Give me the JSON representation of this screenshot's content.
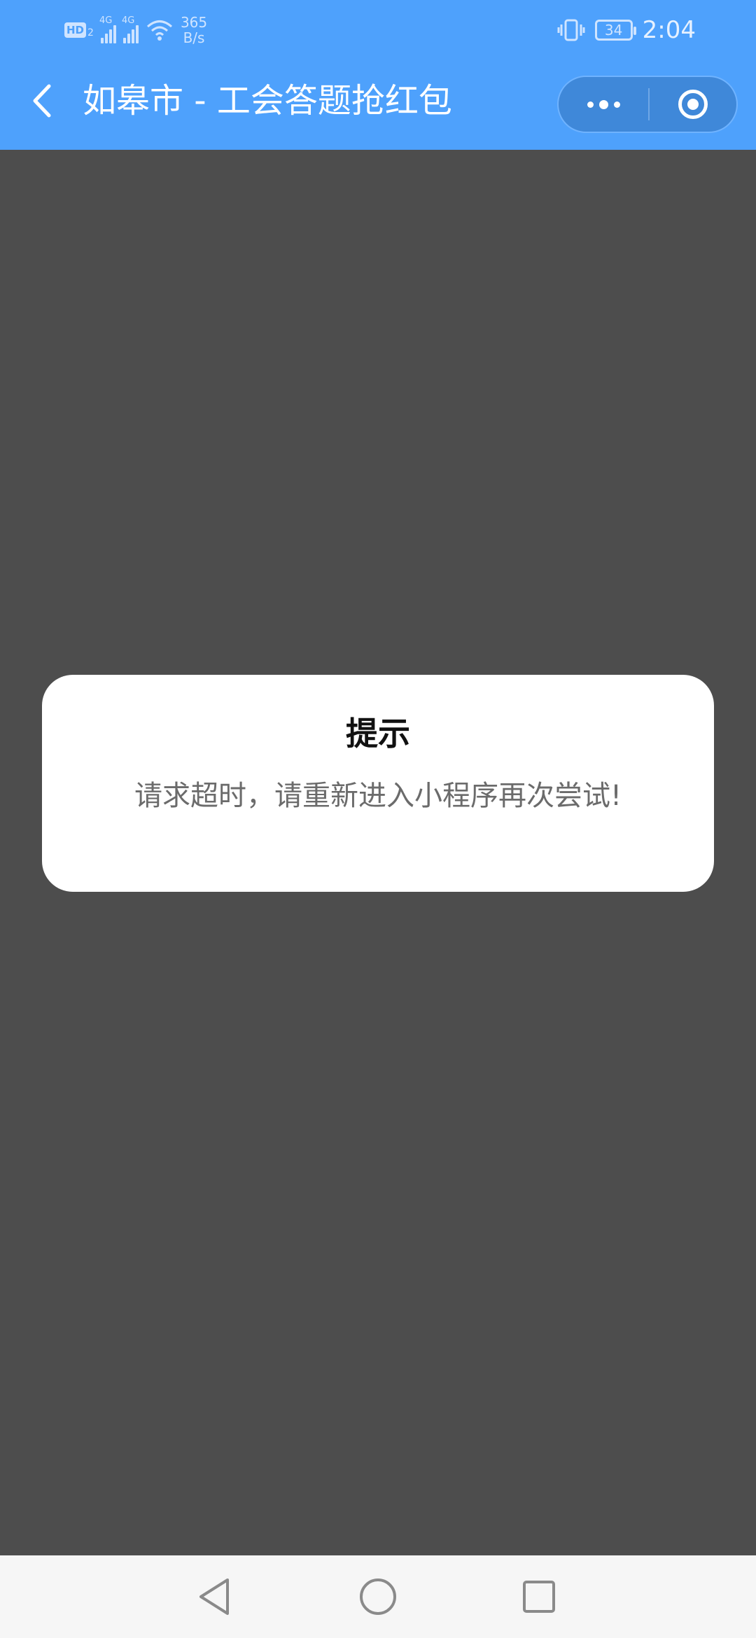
{
  "status_bar": {
    "hd_label": "HD",
    "hd_sub": "2",
    "signal1_label": "4G",
    "signal2_label": "4G",
    "net_speed_value": "365",
    "net_speed_unit": "B/s",
    "battery_level": "34",
    "time": "2:04"
  },
  "nav": {
    "title": "如皋市 - 工会答题抢红包",
    "back_icon": "chevron-left-icon",
    "more_icon": "more-dots-icon",
    "close_icon": "target-circle-icon"
  },
  "modal": {
    "title": "提示",
    "message": "请求超时，请重新进入小程序再次尝试!"
  },
  "system_nav": {
    "back_icon": "triangle-back-icon",
    "home_icon": "circle-home-icon",
    "recents_icon": "square-recents-icon"
  },
  "colors": {
    "header_blue": "#4ea1fc",
    "overlay_gray": "#4d4d4d",
    "modal_bg": "#ffffff"
  }
}
